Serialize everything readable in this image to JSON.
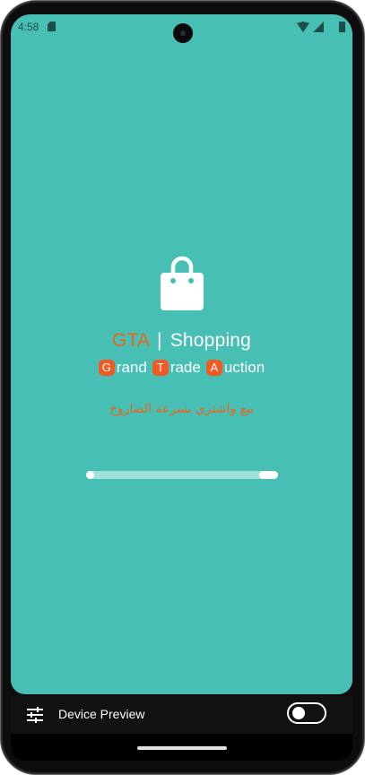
{
  "status_bar": {
    "time": "4:58",
    "icons": [
      "sd-card-icon",
      "wifi-icon",
      "signal-icon",
      "battery-icon"
    ]
  },
  "splash": {
    "icon": "shopping-bag-icon",
    "title_brand": "GTA",
    "title_separator": "|",
    "title_rest": "Shopping",
    "tagline": [
      {
        "letter": "G",
        "rest": "rand"
      },
      {
        "letter": "T",
        "rest": "rade"
      },
      {
        "letter": "A",
        "rest": "uction"
      }
    ],
    "slogan": "بيع واشتري بسرعة الصاروخ",
    "progress": 0.9
  },
  "device_preview": {
    "icon": "tune-icon",
    "label": "Device Preview",
    "toggle_on": false
  },
  "colors": {
    "background": "#48bfb4",
    "accent": "#e8641b",
    "badge": "#f15a22"
  }
}
